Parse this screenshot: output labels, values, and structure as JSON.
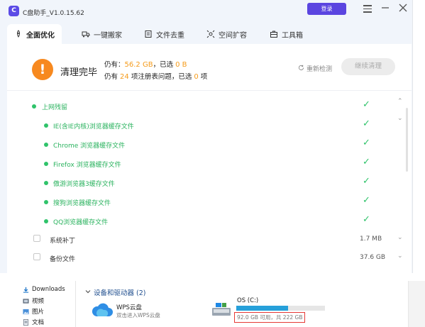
{
  "app": {
    "title": "C盘助手_V1.0.15.62",
    "logo_letter": "C",
    "login_label": "登录",
    "accent": "#5b45e0"
  },
  "tabs": [
    {
      "label": "全面优化",
      "icon": "rocket-icon",
      "active": true
    },
    {
      "label": "一键搬家",
      "icon": "truck-icon",
      "active": false
    },
    {
      "label": "文件去重",
      "icon": "file-icon",
      "active": false
    },
    {
      "label": "空间扩容",
      "icon": "expand-icon",
      "active": false
    },
    {
      "label": "工具箱",
      "icon": "toolbox-icon",
      "active": false
    }
  ],
  "status": {
    "icon_glyph": "!",
    "title": "清理完毕",
    "line1_prefix": "仍有：",
    "line1_value": "56.2 GB",
    "line1_mid": "，已选",
    "line1_selected": "0 B",
    "line2_prefix": "仍有",
    "line2_value": "24",
    "line2_mid": "项注册表问题，已选",
    "line2_selected": "0",
    "line2_suffix": "项",
    "recheck_label": "重新检测",
    "continue_label": "继续清理",
    "warn_color": "#f7891f",
    "highlight_color": "#f59b1a"
  },
  "list": {
    "group": {
      "label": "上网残留"
    },
    "items": [
      {
        "label": "IE(含IE内核)浏览器缓存文件"
      },
      {
        "label": "Chrome 浏览器缓存文件"
      },
      {
        "label": "Firefox 浏览器缓存文件"
      },
      {
        "label": "傲游浏览器3缓存文件"
      },
      {
        "label": "搜狗浏览器缓存文件"
      },
      {
        "label": "QQ浏览器缓存文件"
      }
    ],
    "unchecked": [
      {
        "label": "系统补丁",
        "size": "1.7 MB"
      },
      {
        "label": "备份文件",
        "size": "37.6 GB"
      }
    ],
    "check_glyph": "✓",
    "collapse_glyph": "⌃",
    "expand_glyph": "⌄",
    "green": "#2fc36a"
  },
  "explorer": {
    "sidebar": [
      {
        "label": "Downloads",
        "icon": "download-icon"
      },
      {
        "label": "视频",
        "icon": "video-icon"
      },
      {
        "label": "图片",
        "icon": "picture-icon"
      },
      {
        "label": "文档",
        "icon": "document-icon"
      }
    ],
    "section_title": "设备和驱动器 (2)",
    "cloud": {
      "name": "WPS云盘",
      "subtitle": "双击进入WPS云盘"
    },
    "drive": {
      "name": "OS (C:)",
      "free_text": "92.0 GB 可用，共 222 GB",
      "used_fraction": 0.586
    }
  }
}
